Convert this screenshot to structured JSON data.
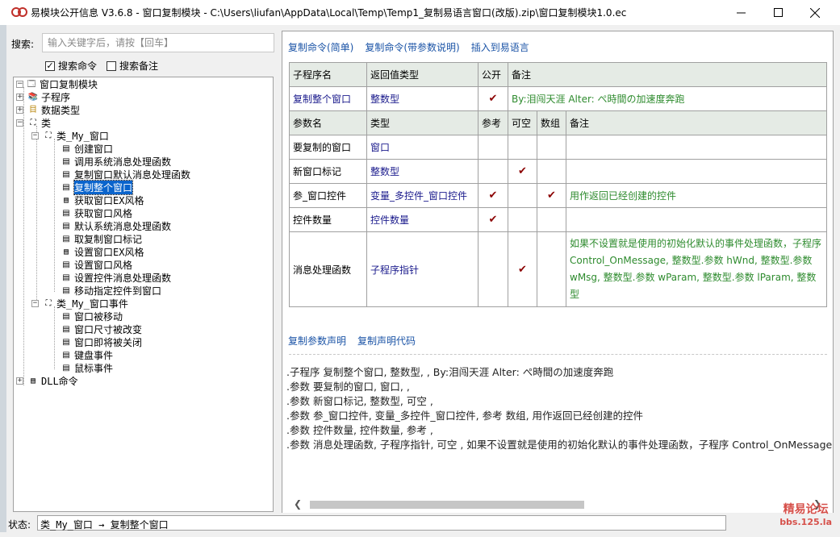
{
  "window": {
    "title": "易模块公开信息 V3.6.8 - 窗口复制模块 - C:\\Users\\liufan\\AppData\\Local\\Temp\\Temp1_复制易语言窗口(改版).zip\\窗口复制模块1.0.ec"
  },
  "search": {
    "label": "搜索:",
    "placeholder": "输入关键字后，请按【回车】",
    "options": [
      {
        "label": "搜索命令",
        "checked": true
      },
      {
        "label": "搜索备注",
        "checked": false
      }
    ]
  },
  "tree": {
    "root": "窗口复制模块",
    "subprogram": "子程序",
    "datatype": "数据类型",
    "class": "类",
    "class_window": "类_My_窗口",
    "class_window_items": [
      "创建窗口",
      "调用系统消息处理函数",
      "复制窗口默认消息处理函数",
      "复制整个窗口",
      "获取窗口EX风格",
      "获取窗口风格",
      "默认系统消息处理函数",
      "取复制窗口标记",
      "设置窗口EX风格",
      "设置窗口风格",
      "设置控件消息处理函数",
      "移动指定控件到窗口"
    ],
    "class_events": "类_My_窗口事件",
    "class_events_items": [
      "窗口被移动",
      "窗口尺寸被改变",
      "窗口即将被关闭",
      "键盘事件",
      "鼠标事件"
    ],
    "dll": "DLL命令"
  },
  "links": {
    "copy_simple": "复制命令(简单)",
    "copy_params": "复制命令(带参数说明)",
    "insert": "插入到易语言",
    "copy_param_decl": "复制参数声明",
    "copy_decl_code": "复制声明代码"
  },
  "table": {
    "header1": {
      "name": "子程序名",
      "ret": "返回值类型",
      "public": "公开",
      "note": "备注"
    },
    "sub": {
      "name": "复制整个窗口",
      "ret": "整数型",
      "public": "✔",
      "note": "By:泪闯天涯 Alter: ぺ時間の加速度奔跑"
    },
    "header2": {
      "name": "参数名",
      "type": "类型",
      "ref": "参考",
      "nullable": "可空",
      "array": "数组",
      "note": "备注"
    },
    "params": [
      {
        "name": "要复制的窗口",
        "type": "窗口",
        "ref": "",
        "nullable": "",
        "array": "",
        "note": ""
      },
      {
        "name": "新窗口标记",
        "type": "整数型",
        "ref": "",
        "nullable": "✔",
        "array": "",
        "note": ""
      },
      {
        "name": "参_窗口控件",
        "type": "变量_多控件_窗口控件",
        "ref": "✔",
        "nullable": "",
        "array": "✔",
        "note": "用作返回已经创建的控件"
      },
      {
        "name": "控件数量",
        "type": "控件数量",
        "ref": "✔",
        "nullable": "",
        "array": "",
        "note": ""
      },
      {
        "name": "消息处理函数",
        "type": "子程序指针",
        "ref": "",
        "nullable": "✔",
        "array": "",
        "note": "如果不设置就是使用的初始化默认的事件处理函数，子程序 Control_OnMessage, 整数型.参数 hWnd, 整数型.参数 wMsg, 整数型.参数 wParam, 整数型.参数 lParam, 整数型"
      }
    ]
  },
  "code_lines": [
    ".子程序 复制整个窗口, 整数型, , By:泪闯天涯 Alter: ぺ時間の加速度奔跑",
    ".参数 要复制的窗口, 窗口, ,",
    ".参数 新窗口标记, 整数型, 可空 ,",
    ".参数 参_窗口控件, 变量_多控件_窗口控件, 参考 数组, 用作返回已经创建的控件",
    ".参数 控件数量, 控件数量, 参考 ,",
    ".参数 消息处理函数, 子程序指针, 可空 , 如果不设置就是使用的初始化默认的事件处理函数，子程序 Control_OnMessage"
  ],
  "status": {
    "label": "状态:",
    "text": "类_My_窗口 → 复制整个窗口"
  },
  "watermark": {
    "line1": "精易论坛",
    "line2": "bbs.125.la"
  },
  "colors": {
    "selection": "#0a64cc",
    "link": "#1a53a6",
    "note_green": "#2e8b2e",
    "type_blue": "#1a1a8c",
    "check_red": "#8b0000",
    "header_bg": "#e5ebe5"
  }
}
